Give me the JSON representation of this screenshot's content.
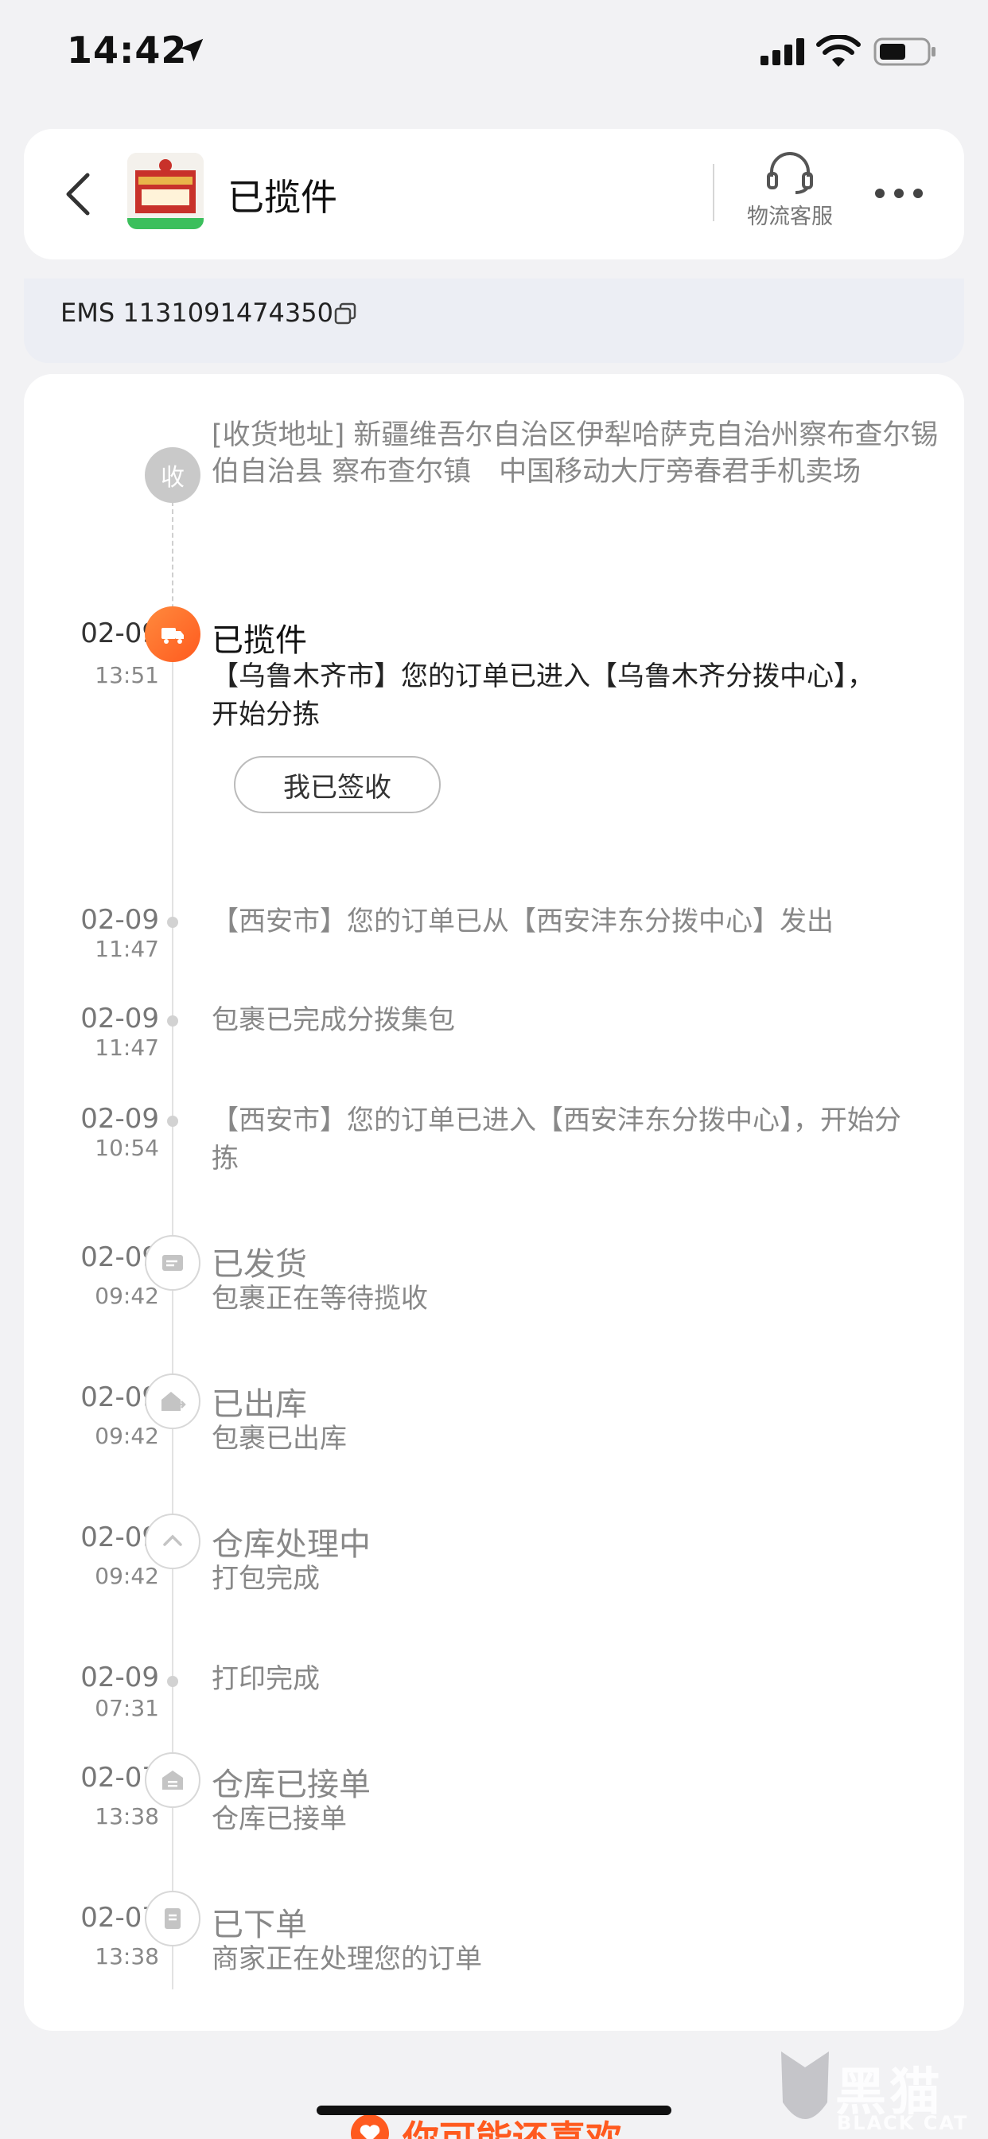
{
  "status_bar": {
    "time": "14:42"
  },
  "header": {
    "title": "已揽件",
    "service_label": "物流客服"
  },
  "tracking": {
    "number": "EMS 1131091474350"
  },
  "timeline": {
    "address": "[收货地址] 新疆维吾尔自治区伊犁哈萨克自治州察布查尔锡伯自治县 察布查尔镇　中国移动大厅旁春君手机卖场",
    "address_badge": "收",
    "events": [
      {
        "date": "02-09",
        "time": "13:51",
        "title": "已揽件",
        "desc": "【乌鲁木齐市】您的订单已进入【乌鲁木齐分拨中心】，开始分拣"
      },
      {
        "date": "02-09",
        "time": "11:47",
        "desc": "【西安市】您的订单已从【西安沣东分拨中心】发出"
      },
      {
        "date": "02-09",
        "time": "11:47",
        "desc": "包裹已完成分拨集包"
      },
      {
        "date": "02-09",
        "time": "10:54",
        "desc": "【西安市】您的订单已进入【西安沣东分拨中心】，开始分拣"
      },
      {
        "date": "02-09",
        "time": "09:42",
        "title": "已发货",
        "desc": "包裹正在等待揽收"
      },
      {
        "date": "02-09",
        "time": "09:42",
        "title": "已出库",
        "desc": "包裹已出库"
      },
      {
        "date": "02-09",
        "time": "09:42",
        "title": "仓库处理中",
        "desc": "打包完成"
      },
      {
        "date": "02-09",
        "time": "07:31",
        "desc": "打印完成"
      },
      {
        "date": "02-07",
        "time": "13:38",
        "title": "仓库已接单",
        "desc": "仓库已接单"
      },
      {
        "date": "02-07",
        "time": "13:38",
        "title": "已下单",
        "desc": "商家正在处理您的订单"
      }
    ],
    "sign_button": "我已签收"
  },
  "bottom": {
    "recommend": "你可能还喜欢"
  },
  "watermark": {
    "text": "黑猫",
    "sub": "BLACK CAT"
  },
  "colors": {
    "accent": "#ff5a1f",
    "background": "#f2f2f4",
    "card": "#ffffff"
  }
}
